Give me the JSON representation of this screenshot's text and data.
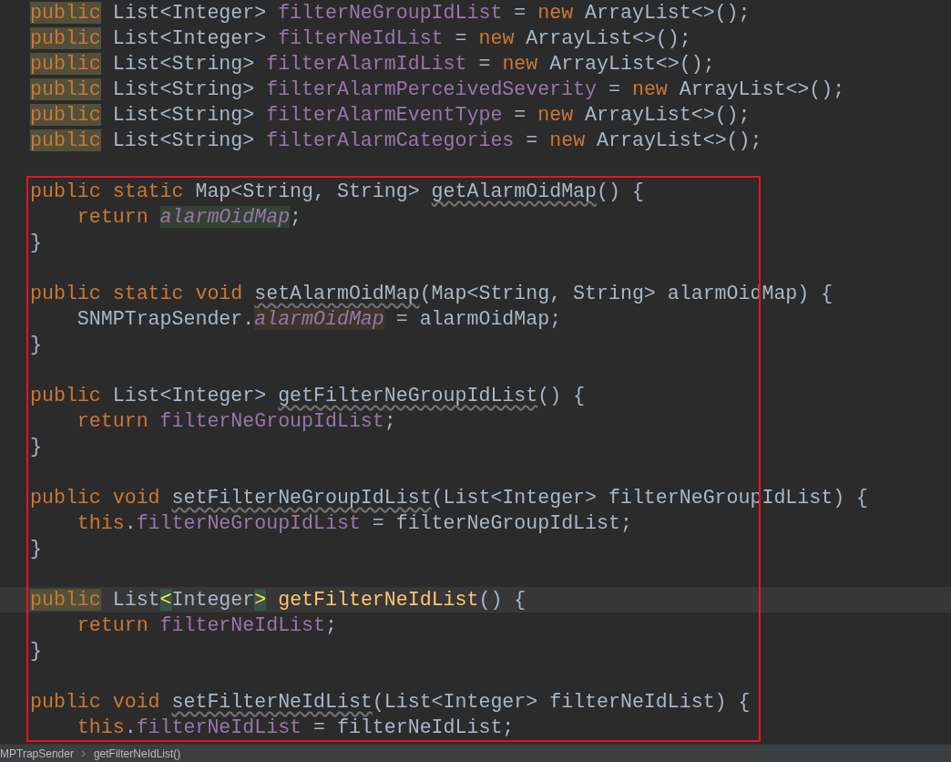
{
  "editor": {
    "blocks": [
      {
        "lines": [
          {
            "current": false,
            "tokens": [
              {
                "text": "public",
                "kind": "keyword",
                "highlighted": true
              },
              {
                "text": " List<Integer> ",
                "kind": "plain"
              },
              {
                "text": "filterNeGroupIdList",
                "kind": "field"
              },
              {
                "text": " = ",
                "kind": "plain"
              },
              {
                "text": "new",
                "kind": "keyword"
              },
              {
                "text": " ArrayList<>();",
                "kind": "plain"
              }
            ]
          },
          {
            "current": false,
            "tokens": [
              {
                "text": "public",
                "kind": "keyword",
                "highlighted": true
              },
              {
                "text": " List<Integer> ",
                "kind": "plain"
              },
              {
                "text": "filterNeIdList",
                "kind": "field"
              },
              {
                "text": " = ",
                "kind": "plain"
              },
              {
                "text": "new",
                "kind": "keyword"
              },
              {
                "text": " ArrayList<>();",
                "kind": "plain"
              }
            ]
          },
          {
            "current": false,
            "tokens": [
              {
                "text": "public",
                "kind": "keyword",
                "highlighted": true
              },
              {
                "text": " List<String> ",
                "kind": "plain"
              },
              {
                "text": "filterAlarmIdList",
                "kind": "field"
              },
              {
                "text": " = ",
                "kind": "plain"
              },
              {
                "text": "new",
                "kind": "keyword"
              },
              {
                "text": " ArrayList<>();",
                "kind": "plain"
              }
            ]
          },
          {
            "current": false,
            "tokens": [
              {
                "text": "public",
                "kind": "keyword",
                "highlighted": true
              },
              {
                "text": " List<String> ",
                "kind": "plain"
              },
              {
                "text": "filterAlarmPerceivedSeverity",
                "kind": "field"
              },
              {
                "text": " = ",
                "kind": "plain"
              },
              {
                "text": "new",
                "kind": "keyword"
              },
              {
                "text": " ArrayList<>();",
                "kind": "plain"
              }
            ]
          },
          {
            "current": false,
            "tokens": [
              {
                "text": "public",
                "kind": "keyword",
                "highlighted": true
              },
              {
                "text": " List<String> ",
                "kind": "plain"
              },
              {
                "text": "filterAlarmEventType",
                "kind": "field"
              },
              {
                "text": " = ",
                "kind": "plain"
              },
              {
                "text": "new",
                "kind": "keyword"
              },
              {
                "text": " ArrayList<>();",
                "kind": "plain"
              }
            ]
          },
          {
            "current": false,
            "tokens": [
              {
                "text": "public",
                "kind": "keyword",
                "highlighted": true
              },
              {
                "text": " List<String> ",
                "kind": "plain"
              },
              {
                "text": "filterAlarmCategories",
                "kind": "field"
              },
              {
                "text": " = ",
                "kind": "plain"
              },
              {
                "text": "new",
                "kind": "keyword"
              },
              {
                "text": " ArrayList<>();",
                "kind": "plain"
              }
            ]
          }
        ]
      },
      {
        "lines": [
          {
            "current": false,
            "tokens": [
              {
                "text": "public static",
                "kind": "keyword"
              },
              {
                "text": " Map<String, String> ",
                "kind": "plain"
              },
              {
                "text": "getAlarmOidMap",
                "kind": "method_ref"
              },
              {
                "text": "() {",
                "kind": "plain"
              }
            ]
          },
          {
            "current": false,
            "tokens": [
              {
                "text": "    return ",
                "kind": "keyword"
              },
              {
                "text": "alarmOidMap",
                "kind": "static_field_read"
              },
              {
                "text": ";",
                "kind": "plain"
              }
            ]
          },
          {
            "current": false,
            "tokens": [
              {
                "text": "}",
                "kind": "plain"
              }
            ]
          }
        ]
      },
      {
        "lines": [
          {
            "current": false,
            "tokens": [
              {
                "text": "public static void ",
                "kind": "keyword"
              },
              {
                "text": "setAlarmOidMap",
                "kind": "method_ref"
              },
              {
                "text": "(Map<String, String> alarmOidMap) {",
                "kind": "plain"
              }
            ]
          },
          {
            "current": false,
            "tokens": [
              {
                "text": "    SNMPTrapSender.",
                "kind": "plain"
              },
              {
                "text": "alarmOidMap",
                "kind": "static_field_write"
              },
              {
                "text": " = alarmOidMap;",
                "kind": "plain"
              }
            ]
          },
          {
            "current": false,
            "tokens": [
              {
                "text": "}",
                "kind": "plain"
              }
            ]
          }
        ]
      },
      {
        "lines": [
          {
            "current": false,
            "tokens": [
              {
                "text": "public",
                "kind": "keyword"
              },
              {
                "text": " List<Integer> ",
                "kind": "plain"
              },
              {
                "text": "getFilterNeGroupIdList",
                "kind": "method_ref"
              },
              {
                "text": "() {",
                "kind": "plain"
              }
            ]
          },
          {
            "current": false,
            "tokens": [
              {
                "text": "    return ",
                "kind": "keyword"
              },
              {
                "text": "filterNeGroupIdList",
                "kind": "field"
              },
              {
                "text": ";",
                "kind": "plain"
              }
            ]
          },
          {
            "current": false,
            "tokens": [
              {
                "text": "}",
                "kind": "plain"
              }
            ]
          }
        ]
      },
      {
        "lines": [
          {
            "current": false,
            "tokens": [
              {
                "text": "public void ",
                "kind": "keyword"
              },
              {
                "text": "setFilterNeGroupIdList",
                "kind": "method_ref"
              },
              {
                "text": "(List<Integer> filterNeGroupIdList) {",
                "kind": "plain"
              }
            ]
          },
          {
            "current": false,
            "tokens": [
              {
                "text": "    this",
                "kind": "keyword"
              },
              {
                "text": ".",
                "kind": "plain"
              },
              {
                "text": "filterNeGroupIdList",
                "kind": "field"
              },
              {
                "text": " = filterNeGroupIdList;",
                "kind": "plain"
              }
            ]
          },
          {
            "current": false,
            "tokens": [
              {
                "text": "}",
                "kind": "plain"
              }
            ]
          }
        ]
      },
      {
        "lines": [
          {
            "current": true,
            "tokens": [
              {
                "text": "public",
                "kind": "keyword",
                "highlighted": true
              },
              {
                "text": " List",
                "kind": "plain"
              },
              {
                "text": "<",
                "kind": "bracket_match"
              },
              {
                "text": "Integer",
                "kind": "plain"
              },
              {
                "text": ">",
                "kind": "bracket_match"
              },
              {
                "text": " getFilterNeIdList",
                "kind": "method_decl"
              },
              {
                "text": "() {",
                "kind": "plain"
              }
            ]
          },
          {
            "current": false,
            "tokens": [
              {
                "text": "    return ",
                "kind": "keyword"
              },
              {
                "text": "filterNeIdList",
                "kind": "field"
              },
              {
                "text": ";",
                "kind": "plain"
              }
            ]
          },
          {
            "current": false,
            "tokens": [
              {
                "text": "}",
                "kind": "plain"
              }
            ]
          }
        ]
      },
      {
        "lines": [
          {
            "current": false,
            "tokens": [
              {
                "text": "public void ",
                "kind": "keyword"
              },
              {
                "text": "setFilterNeIdList",
                "kind": "method_ref"
              },
              {
                "text": "(List<Integer> filterNeIdList) {",
                "kind": "plain"
              }
            ]
          },
          {
            "current": false,
            "tokens": [
              {
                "text": "    this",
                "kind": "keyword"
              },
              {
                "text": ".",
                "kind": "plain"
              },
              {
                "text": "filterNeIdList",
                "kind": "field"
              },
              {
                "text": " = filterNeIdList;",
                "kind": "plain"
              }
            ]
          }
        ]
      }
    ]
  },
  "breadcrumb": [
    "MPTrapSender",
    "getFilterNeIdList()"
  ]
}
